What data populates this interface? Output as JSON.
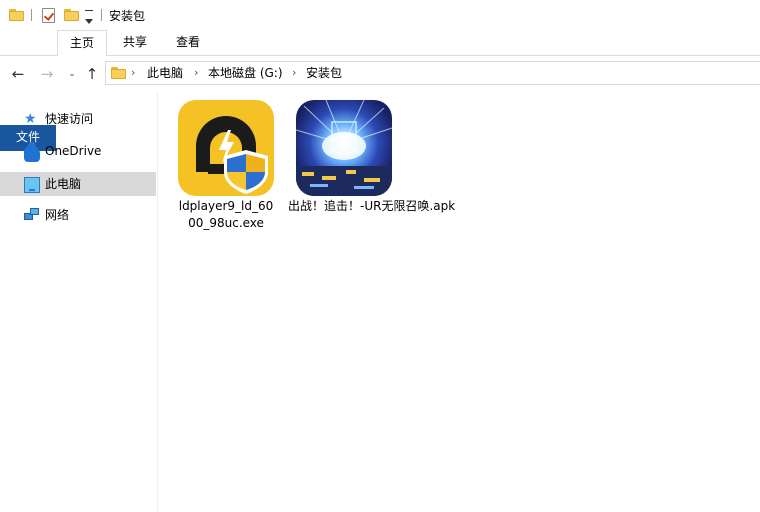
{
  "window": {
    "title": "安装包"
  },
  "quick_access_toolbar": {
    "icons": [
      "folder-icon",
      "properties-icon",
      "new-folder-icon",
      "dropdown-icon"
    ]
  },
  "ribbon": {
    "tabs": [
      {
        "label": "文件"
      },
      {
        "label": "主页"
      },
      {
        "label": "共享"
      },
      {
        "label": "查看"
      }
    ]
  },
  "address_bar": {
    "breadcrumbs": [
      {
        "label": "此电脑"
      },
      {
        "label": "本地磁盘 (G:)"
      },
      {
        "label": "安装包"
      }
    ]
  },
  "navigation": {
    "items": [
      {
        "label": "快速访问",
        "icon": "star-icon"
      },
      {
        "label": "OneDrive",
        "icon": "cloud-icon"
      },
      {
        "label": "此电脑",
        "icon": "computer-icon",
        "selected": true
      },
      {
        "label": "网络",
        "icon": "network-icon"
      }
    ]
  },
  "files": [
    {
      "name_line1": "ldplayer9_ld_60",
      "name_line2": "00_98uc.exe",
      "icon": "ldplayer-app-icon"
    },
    {
      "name_line1": "出战！追击！-UR无限召唤.apk",
      "icon": "game-app-icon"
    }
  ],
  "colors": {
    "file_tab": "#19569e",
    "selection": "#d9d9d9",
    "ldplayer_yellow": "#f4c224"
  }
}
